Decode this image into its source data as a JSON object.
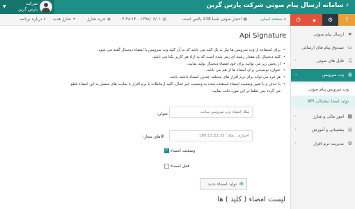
{
  "header": {
    "title": "سامانه ارسال پیام صوتی شرکت پارس گرین",
    "user_line1": "شرکت",
    "user_line2": "پارس گرین"
  },
  "breadcrumb": {
    "home": "صفحه اصلی",
    "credit": "اعتبار صوتی شما 238 پالس است",
    "date": "۱۳۹۸/۰۶/۰۱ - ۰۴:۴۸:۱۴",
    "buy": "خرید شارژ",
    "gift": "شارژ هدیه",
    "about": "درباره برنامه"
  },
  "quick_buttons": [
    {
      "icon": "power",
      "color": "#e0513e"
    },
    {
      "icon": "lock",
      "color": "#e0513e"
    },
    {
      "icon": "gear",
      "color": "#2a3940"
    },
    {
      "icon": "help",
      "color": "#e8a03c"
    }
  ],
  "sidebar": {
    "items": [
      {
        "label": "ارسال پیام صوتی",
        "icon": "send-icon"
      },
      {
        "label": "صندوق پیام های ارسالی",
        "icon": "inbox-icon"
      },
      {
        "label": "فایل های صوتی",
        "icon": "music-icon"
      },
      {
        "label": "وب سرویس",
        "icon": "globe-icon"
      },
      {
        "label": "امور مالی و شارژ",
        "icon": "money-icon"
      },
      {
        "label": "پشتیبانی و آموزش",
        "icon": "support-icon"
      },
      {
        "label": "مدیریت نرم افزار",
        "icon": "settings-icon"
      }
    ],
    "sub_items": [
      {
        "label": "وب سرویس پیام صوتی"
      },
      {
        "label": "تولید امضا دیجیتالی API"
      }
    ]
  },
  "main": {
    "title": "Api Signature",
    "bullets": [
      "برای استفاده از وب سرویس ها نیاز به یک کلید می باشد که به آن کلید وب سرویس یا امضاء دیجیتال گفته می شود.",
      "کلید دیجیتال یک مقدار رشته ای رمز شده است که به ازاء هر کاربر یکتا می باشد.",
      "از بخش زیر می توانید برای خود امضاء دیجیتال تولید نمایید.",
      "عنوان: توضیحی برای امضاء ها از هم می باشد.",
      "هر فرد می تواند برای نرم افزار های مختلف چندین امضاء داشته باشد.",
      "با حذف و یا تغییر وضعیت امضاء استفاده شده به وضعیت غیر فعال، کلیه ارتباطات با نرم افزار یا سایت های متصل به این امضاء قطع می گردد پس لطفا در این مورد دقت نمایید."
    ],
    "title_label": "عنوان:",
    "title_placeholder": "مثلا: امضاء وب سرویس سایت",
    "ip_label": "IPهای مجاز:",
    "ip_placeholder": "اختیاری . مثلا : 185.13.22.33",
    "signature_status_label": "وضعیت امضاء",
    "signature_status_checked": true,
    "lock_label": "قفل امضاء",
    "lock_checked": false,
    "generate_button": "تولید امضاء جدید",
    "list_title": "لیست امضاء ( کلید ) ها"
  }
}
